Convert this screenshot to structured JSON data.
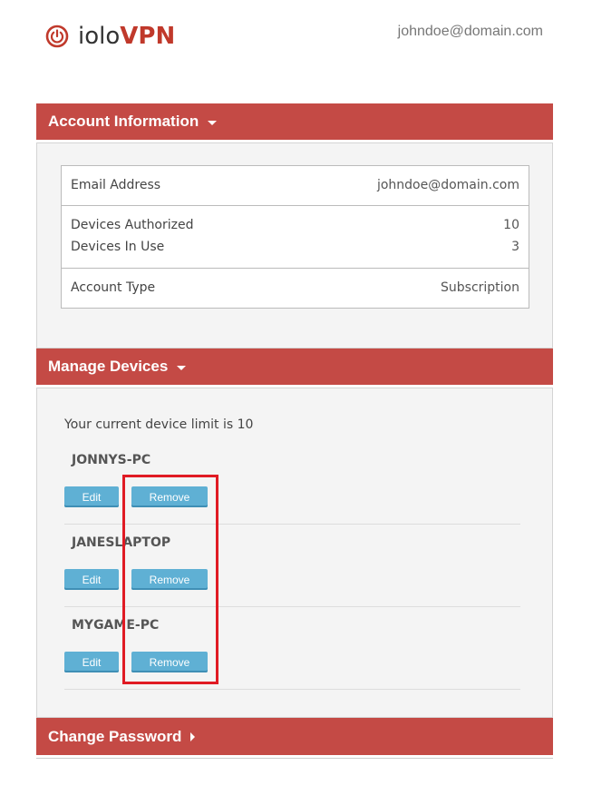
{
  "header": {
    "logo_text_1": "iolo",
    "logo_text_2": "VPN",
    "user_email": "johndoe@domain.com"
  },
  "account": {
    "title": "Account Information",
    "email_label": "Email Address",
    "email_value": "johndoe@domain.com",
    "devices_authorized_label": "Devices Authorized",
    "devices_authorized_value": "10",
    "devices_in_use_label": "Devices In Use",
    "devices_in_use_value": "3",
    "account_type_label": "Account Type",
    "account_type_value": "Subscription"
  },
  "manage": {
    "title": "Manage Devices",
    "limit_text": "Your current device limit is 10",
    "devices": [
      {
        "name": "JONNYS-PC",
        "edit": "Edit",
        "remove": "Remove"
      },
      {
        "name": "JANESLAPTOP",
        "edit": "Edit",
        "remove": "Remove"
      },
      {
        "name": "MYGAME-PC",
        "edit": "Edit",
        "remove": "Remove"
      }
    ]
  },
  "password": {
    "title": "Change Password"
  },
  "colors": {
    "brand": "#c44a45",
    "button": "#5fb0d4",
    "highlight": "#e01b24"
  }
}
